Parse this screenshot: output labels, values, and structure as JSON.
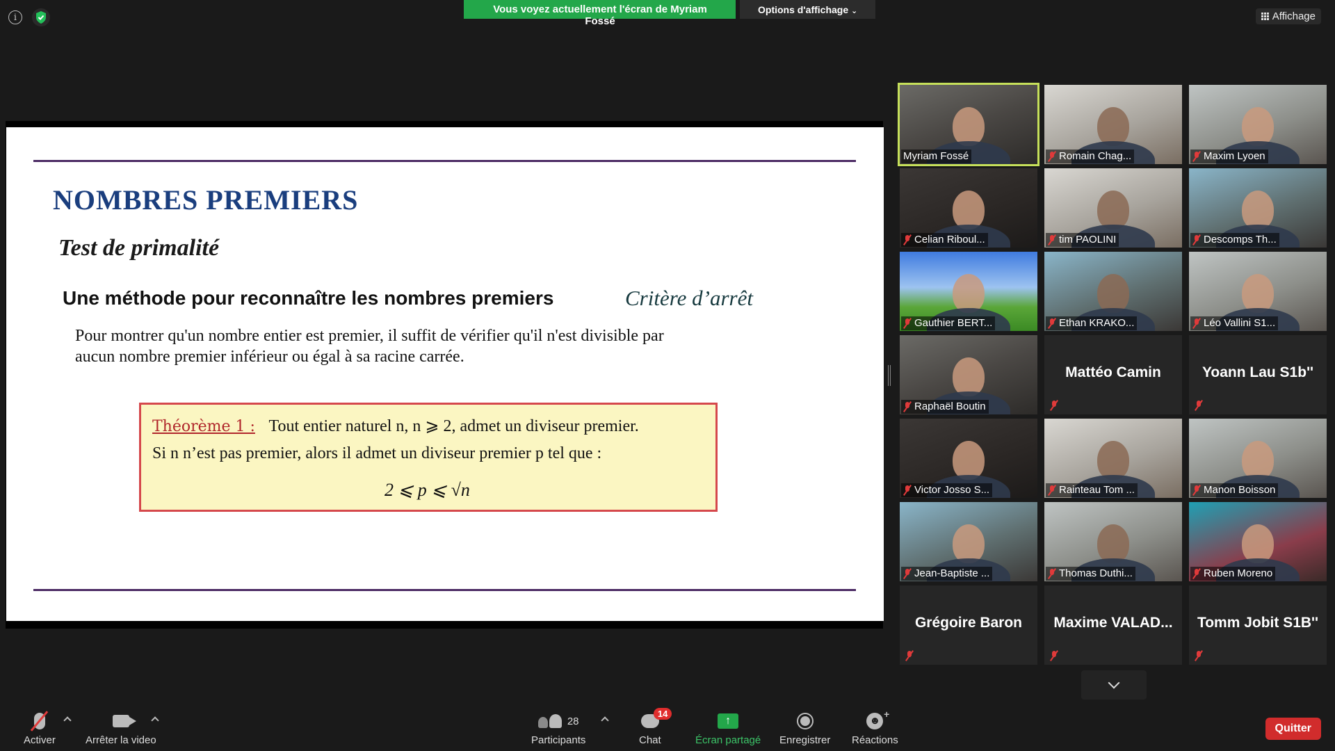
{
  "top": {
    "banner": "Vous voyez actuellement l'écran de Myriam Fossé",
    "options": "Options d'affichage",
    "view": "Affichage"
  },
  "slide": {
    "title": "NOMBRES PREMIERS",
    "subtitle": "Test de primalité",
    "heading": "Une méthode pour reconnaître les nombres premiers",
    "criterion": "Critère d’arrêt",
    "para_line1": "Pour montrer qu'un nombre entier est premier, il suffit de vérifier qu'il n'est divisible par",
    "para_line2": "aucun nombre premier inférieur ou égal à sa racine carrée.",
    "theorem_label": "Théorème 1 :",
    "theorem_line1": "Tout entier naturel n, n ⩾ 2, admet un diviseur premier.",
    "theorem_line2": "Si n n’est pas premier, alors il admet un diviseur premier p tel que :",
    "theorem_formula": "2 ⩽ p ⩽ √n"
  },
  "participants": [
    {
      "name": "Myriam Fossé",
      "video": true,
      "muted": false
    },
    {
      "name": "Romain Chag...",
      "video": true,
      "muted": true
    },
    {
      "name": "Maxim Lyoen",
      "video": true,
      "muted": true
    },
    {
      "name": "Celian Riboul...",
      "video": true,
      "muted": true
    },
    {
      "name": "tim PAOLINI",
      "video": true,
      "muted": true
    },
    {
      "name": "Descomps Th...",
      "video": true,
      "muted": true
    },
    {
      "name": "Gauthier BERT...",
      "video": true,
      "muted": true
    },
    {
      "name": "Ethan KRAKO...",
      "video": true,
      "muted": true
    },
    {
      "name": "Léo Vallini S1...",
      "video": true,
      "muted": true
    },
    {
      "name": "Raphaël Boutin",
      "video": true,
      "muted": true
    },
    {
      "name": "Mattéo Camin",
      "video": false,
      "muted": true
    },
    {
      "name": "Yoann Lau S1b''",
      "video": false,
      "muted": true
    },
    {
      "name": "Victor Josso S...",
      "video": true,
      "muted": true
    },
    {
      "name": "Rainteau Tom ...",
      "video": true,
      "muted": true
    },
    {
      "name": "Manon Boisson",
      "video": true,
      "muted": true
    },
    {
      "name": "Jean-Baptiste ...",
      "video": true,
      "muted": true
    },
    {
      "name": "Thomas Duthi...",
      "video": true,
      "muted": true
    },
    {
      "name": "Ruben Moreno",
      "video": true,
      "muted": true
    },
    {
      "name": "Grégoire Baron",
      "video": false,
      "muted": true
    },
    {
      "name": "Maxime  VALAD...",
      "video": false,
      "muted": true
    },
    {
      "name": "Tomm Jobit S1B''",
      "video": false,
      "muted": true
    }
  ],
  "toolbar": {
    "unmute": "Activer",
    "stop_video": "Arrêter la video",
    "participants": "Participants",
    "participants_count": "28",
    "chat": "Chat",
    "chat_badge": "14",
    "share": "Écran partagé",
    "record": "Enregistrer",
    "reactions": "Réactions",
    "quit": "Quitter"
  }
}
